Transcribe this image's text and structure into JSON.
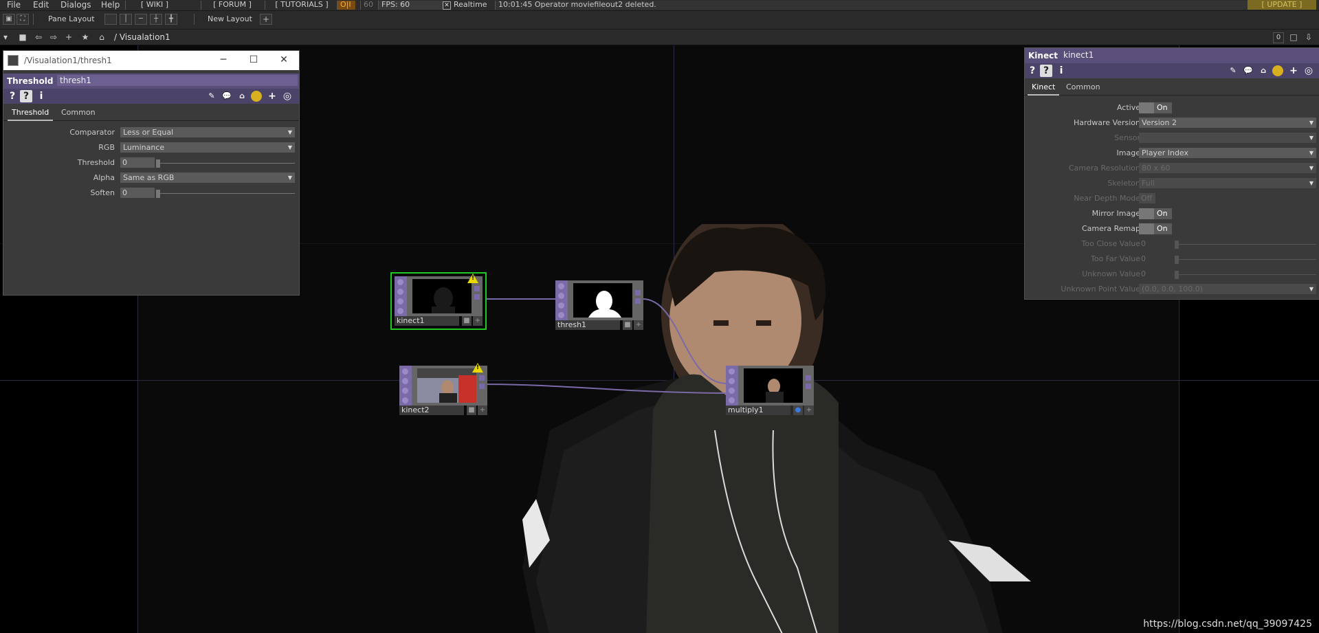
{
  "menubar": {
    "items": [
      "File",
      "Edit",
      "Dialogs",
      "Help"
    ],
    "wiki": "[ WIKI ]",
    "forum": "[ FORUM ]",
    "tutorials": "[ TUTORIALS ]",
    "oi": "O|I",
    "fps_limit": "60",
    "fps": "FPS:  60",
    "realtime": "Realtime",
    "status": "10:01:45 Operator moviefileout2 deleted.",
    "update": "[ UPDATE ]"
  },
  "toolbar": {
    "pane_layout": "Pane Layout",
    "new_layout": "New Layout"
  },
  "pathbar": {
    "path": "/ Visualation1",
    "counter": "0"
  },
  "threshwin": {
    "title": "/Visualation1/thresh1",
    "op_type": "Threshold",
    "op_name": "thresh1",
    "tabs": [
      "Threshold",
      "Common"
    ],
    "params": {
      "comparator_label": "Comparator",
      "comparator_value": "Less or Equal",
      "rgb_label": "RGB",
      "rgb_value": "Luminance",
      "threshold_label": "Threshold",
      "threshold_value": "0",
      "alpha_label": "Alpha",
      "alpha_value": "Same as RGB",
      "soften_label": "Soften",
      "soften_value": "0"
    }
  },
  "kinectpanel": {
    "op_type": "Kinect",
    "op_name": "kinect1",
    "tabs": [
      "Kinect",
      "Common"
    ],
    "params": {
      "active_label": "Active",
      "active_value": "On",
      "hwver_label": "Hardware Version",
      "hwver_value": "Version 2",
      "sensor_label": "Sensor",
      "image_label": "Image",
      "image_value": "Player Index",
      "camres_label": "Camera Resolution",
      "camres_value": "80 x 60",
      "skeleton_label": "Skeleton",
      "skeleton_value": "Full",
      "neardepth_label": "Near Depth Mode",
      "neardepth_value": "Off",
      "mirror_label": "Mirror Image",
      "mirror_value": "On",
      "remap_label": "Camera Remap",
      "remap_value": "On",
      "tooclose_label": "Too Close Value",
      "tooclose_value": "0",
      "toofar_label": "Too Far Value",
      "toofar_value": "0",
      "unknown_label": "Unknown Value",
      "unknown_value": "0",
      "unknownpt_label": "Unknown Point Value",
      "unknownpt_value": "(0.0, 0.0, 100.0)"
    }
  },
  "nodes": {
    "kinect1": "kinect1",
    "thresh1": "thresh1",
    "kinect2": "kinect2",
    "multiply1": "multiply1"
  },
  "watermark": "https://blog.csdn.net/qq_39097425",
  "colors": {
    "op_header": "#5a4f7a",
    "node_port": "#7a6aa8",
    "warning": "#e8d800",
    "selected_outline": "#22c822",
    "wire": "#7a6aa8"
  }
}
